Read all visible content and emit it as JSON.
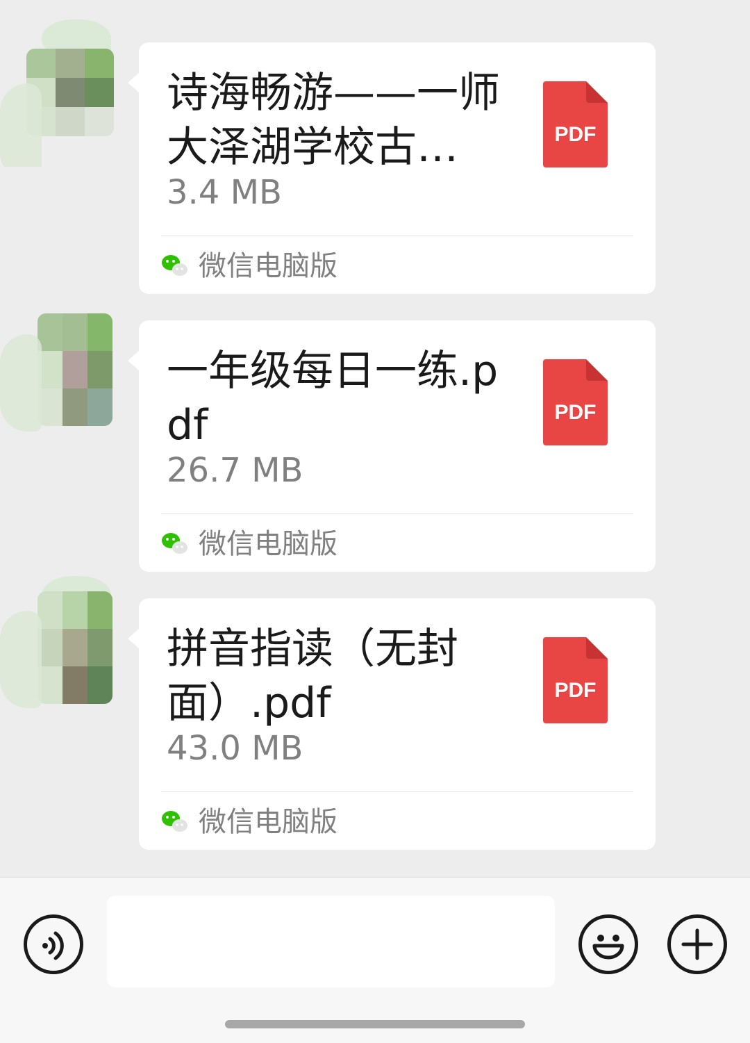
{
  "messages": [
    {
      "file_name": "诗海畅游——一师大泽湖学校古…",
      "file_size": "3.4 MB",
      "file_type": "PDF",
      "source": "微信电脑版"
    },
    {
      "file_name": "一年级每日一练.pdf",
      "file_size": "26.7 MB",
      "file_type": "PDF",
      "source": "微信电脑版"
    },
    {
      "file_name": "拼音指读（无封面）.pdf",
      "file_size": "43.0 MB",
      "file_type": "PDF",
      "source": "微信电脑版"
    }
  ],
  "input_bar": {
    "message_value": "",
    "voice_icon": "voice-icon",
    "emoji_icon": "emoji-icon",
    "plus_icon": "plus-icon"
  },
  "colors": {
    "pdf_red": "#e84545",
    "pdf_fold": "#c73333",
    "wechat_green": "#2dc100",
    "background": "#ededed"
  }
}
